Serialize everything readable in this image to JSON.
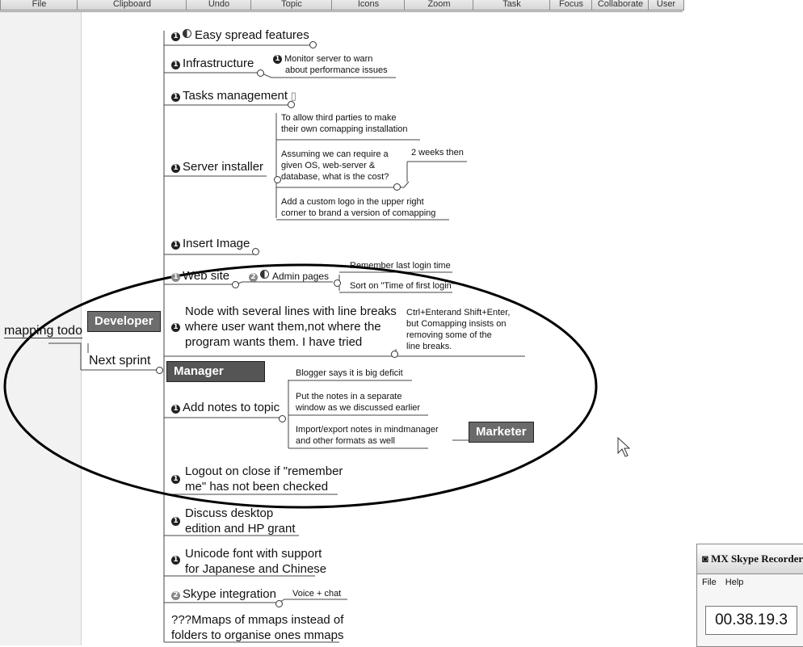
{
  "toolbar": [
    "File",
    "Clipboard",
    "Undo",
    "Topic",
    "Icons",
    "Zoom",
    "Task",
    "Focus",
    "Collaborate",
    "User"
  ],
  "root": {
    "label": "mapping todo"
  },
  "sprint": {
    "label": "Next sprint"
  },
  "tags": {
    "developer": "Developer",
    "manager": "Manager",
    "marketer": "Marketer"
  },
  "topics": {
    "easy": "Easy spread features",
    "infra": "Infrastructure",
    "infra_note": [
      "Monitor server to warn",
      "about performance issues"
    ],
    "tasks": "Tasks management",
    "server": "Server installer",
    "server_n1": [
      "To allow third parties to make",
      "their own comapping installation"
    ],
    "server_n2": [
      "Assuming we can require a",
      "given OS, web-server &",
      "database, what is the cost?"
    ],
    "server_n2b": "2 weeks then",
    "server_n3": [
      "Add a custom logo in the upper right",
      "corner to brand a version of comapping"
    ],
    "insert": "Insert Image",
    "web": "Web site",
    "admin": "Admin pages",
    "admin_n1": "Remember last login time",
    "admin_n2": "Sort on \"Time of first login\"",
    "nodelines": [
      "Node with several lines with line breaks",
      "where user want them,not where the",
      "program wants them. I have tried"
    ],
    "nodelines_note": [
      "Ctrl+Enterand Shift+Enter,",
      "but Comapping insists on",
      "removing some of the",
      "line breaks."
    ],
    "notes": "Add notes to topic",
    "notes_n1": "Blogger says it is big deficit",
    "notes_n2": [
      "Put the notes in a separate",
      "window as we discussed earlier"
    ],
    "notes_n3": [
      "Import/export notes in mindmanager",
      "and other formats as well"
    ],
    "logout": [
      "Logout on close if \"remember",
      "me\" has not been checked"
    ],
    "desktop": [
      "Discuss desktop",
      "edition and HP grant"
    ],
    "unicode": [
      "Unicode font with support",
      "for Japanese and Chinese"
    ],
    "skype": "Skype integration",
    "skype_note": "Voice + chat",
    "mmaps": [
      "???Mmaps of mmaps instead of",
      "folders to organise ones mmaps"
    ]
  },
  "badges": {
    "one": "1",
    "two": "2"
  },
  "recorder": {
    "title": "MX Skype Recorder",
    "menu": [
      "File",
      "Help"
    ],
    "time": "00.38.19.3"
  }
}
